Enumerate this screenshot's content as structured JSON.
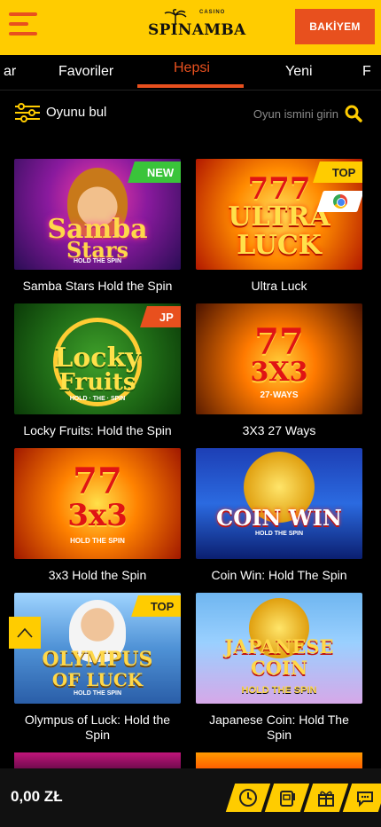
{
  "header": {
    "logo_small": "CASINO",
    "logo_text": "SPINAMBA",
    "deposit_label": "BAKİYEM"
  },
  "tabs": [
    {
      "label": "ar"
    },
    {
      "label": "Favoriler"
    },
    {
      "label": "Hepsi",
      "active": true
    },
    {
      "label": "Yeni"
    },
    {
      "label": "F"
    }
  ],
  "search": {
    "filter_label": "Oyunu bul",
    "placeholder": "Oyun ismini girin"
  },
  "games": [
    {
      "title": "Samba Stars Hold the Spin",
      "badge": "NEW",
      "art_line1": "Samba",
      "art_line2": "Stars",
      "art_sub": "HOLD THE SPIN"
    },
    {
      "title": "Ultra Luck",
      "badge": "TOP",
      "art_line1": "777",
      "art_line2": "ULTRA",
      "art_line3": "LUCK"
    },
    {
      "title": "Locky Fruits: Hold the Spin",
      "badge": "JP",
      "art_line1": "Locky",
      "art_line2": "Fruits",
      "art_sub": "HOLD · THE · SPIN"
    },
    {
      "title": "3X3 27 Ways",
      "badge": "",
      "art_line1": "77",
      "art_line2": "3X3",
      "art_sub": "27·WAYS"
    },
    {
      "title": "3x3 Hold the Spin",
      "badge": "",
      "art_line1": "77",
      "art_line2": "3x3",
      "art_sub": "HOLD THE SPIN"
    },
    {
      "title": "Coin Win: Hold The Spin",
      "badge": "",
      "art_line1": "COIN WIN",
      "art_sub": "HOLD THE SPIN"
    },
    {
      "title": "Olympus of Luck: Hold the Spin",
      "badge": "TOP",
      "art_line1": "OLYMPUS",
      "art_line2": "OF LUCK",
      "art_sub": "HOLD THE SPIN"
    },
    {
      "title": "Japanese Coin: Hold The Spin",
      "badge": "",
      "art_line1": "JAPANESE",
      "art_line2": "COIN",
      "art_sub": "HOLD THE SPIN"
    }
  ],
  "footer": {
    "balance": "0,00 ZŁ",
    "buttons": [
      "clock-icon",
      "slot-machine-icon",
      "gift-icon",
      "chat-icon"
    ]
  },
  "colors": {
    "brand_yellow": "#ffcc00",
    "brand_orange": "#e8501e",
    "badge_new": "#3ac43a"
  }
}
